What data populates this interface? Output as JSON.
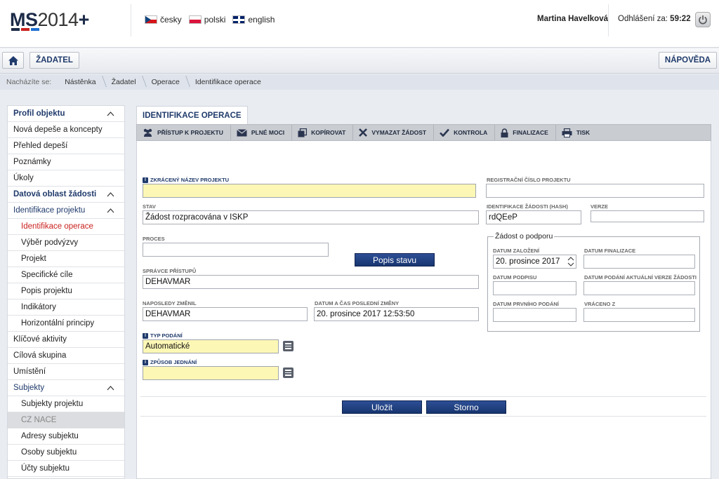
{
  "app": {
    "logo": {
      "bold": "MS",
      "num": "2014",
      "plus": "+"
    },
    "languages": [
      {
        "label": "česky",
        "flag": "cz"
      },
      {
        "label": "polski",
        "flag": "pl"
      },
      {
        "label": "english",
        "flag": "en"
      }
    ],
    "user_name": "Martina Havelková",
    "logout_label": "Odhlášení za:",
    "logout_time": "59:22"
  },
  "toolbar": {
    "applicant_label": "ŽADATEL",
    "help_label": "NÁPOVĚDA"
  },
  "breadcrumb": {
    "label": "Nacházíte se:",
    "items": [
      "Nástěnka",
      "Žadatel",
      "Operace",
      "Identifikace operace"
    ]
  },
  "nav": {
    "items": [
      {
        "label": "Profil objektu"
      },
      {
        "label": "Nová depeše a koncepty"
      },
      {
        "label": "Přehled depeší"
      },
      {
        "label": "Poznámky"
      },
      {
        "label": "Úkoly"
      },
      {
        "label": "Datová oblast žádosti"
      },
      {
        "label": "Identifikace projektu"
      },
      {
        "label": "Identifikace operace"
      },
      {
        "label": "Výběr podvýzvy"
      },
      {
        "label": "Projekt"
      },
      {
        "label": "Specifické cíle"
      },
      {
        "label": "Popis projektu"
      },
      {
        "label": "Indikátory"
      },
      {
        "label": "Horizontální principy"
      },
      {
        "label": "Klíčové aktivity"
      },
      {
        "label": "Cílová skupina"
      },
      {
        "label": "Umístění"
      },
      {
        "label": "Subjekty"
      },
      {
        "label": "Subjekty projektu"
      },
      {
        "label": "CZ NACE"
      },
      {
        "label": "Adresy subjektu"
      },
      {
        "label": "Osoby subjektu"
      },
      {
        "label": "Účty subjektu"
      }
    ]
  },
  "main": {
    "tab_label": "IDENTIFIKACE OPERACE",
    "actions": [
      {
        "label": "PŘÍSTUP K PROJEKTU",
        "icon": "users-icon"
      },
      {
        "label": "PLNÉ MOCI",
        "icon": "envelope-icon"
      },
      {
        "label": "KOPÍROVAT",
        "icon": "copy-icon"
      },
      {
        "label": "VYMAZAT ŽÁDOST",
        "icon": "x-icon"
      },
      {
        "label": "KONTROLA",
        "icon": "check-icon"
      },
      {
        "label": "FINALIZACE",
        "icon": "lock-icon"
      },
      {
        "label": "TISK",
        "icon": "printer-icon"
      }
    ],
    "form": {
      "short_name_label": "ZKRÁCENÝ NÁZEV PROJEKTU",
      "short_name_value": "",
      "reg_number_label": "REGISTRAČNÍ ČÍSLO PROJEKTU",
      "reg_number_value": "",
      "state_label": "STAV",
      "state_value": "Žádost rozpracována v ISKP",
      "hash_label": "IDENTIFIKACE ŽÁDOSTI (HASH)",
      "hash_value": "rdQEeP",
      "version_label": "VERZE",
      "version_value": "",
      "process_label": "PROCES",
      "process_value": "",
      "state_desc_button": "Popis stavu",
      "access_admin_label": "SPRÁVCE PŘÍSTUPŮ",
      "access_admin_value": "DEHAVMAR",
      "last_changed_by_label": "NAPOSLEDY ZMĚNIL",
      "last_changed_by_value": "DEHAVMAR",
      "last_change_date_label": "DATUM A ČAS POSLEDNÍ ZMĚNY",
      "last_change_date_value": "20. prosince 2017 12:53:50",
      "submission_type_label": "TYP PODÁNÍ",
      "submission_type_value": "Automatické",
      "procedure_label": "ZPŮSOB JEDNÁNÍ",
      "procedure_value": "",
      "support_group_label": "Žádost o podporu",
      "created_date_label": "DATUM ZALOŽENÍ",
      "created_date_value": "20. prosince 2017",
      "finalized_date_label": "DATUM FINALIZACE",
      "finalized_date_value": "",
      "signed_date_label": "DATUM PODPISU",
      "signed_date_value": "",
      "current_submit_date_label": "DATUM PODÁNÍ AKTUÁLNÍ VERZE ŽÁDOSTI",
      "current_submit_date_value": "",
      "first_submit_date_label": "DATUM PRVNÍHO PODÁNÍ",
      "first_submit_date_value": "",
      "returned_to_label": "VRÁCENO Z",
      "returned_to_value": "",
      "save_label": "Uložit",
      "cancel_label": "Storno"
    }
  },
  "colors": {
    "accent": "#1f3a6b",
    "active_nav": "#c9211e",
    "required_bg": "#fdf7b5",
    "primary_button": "#17356f"
  }
}
